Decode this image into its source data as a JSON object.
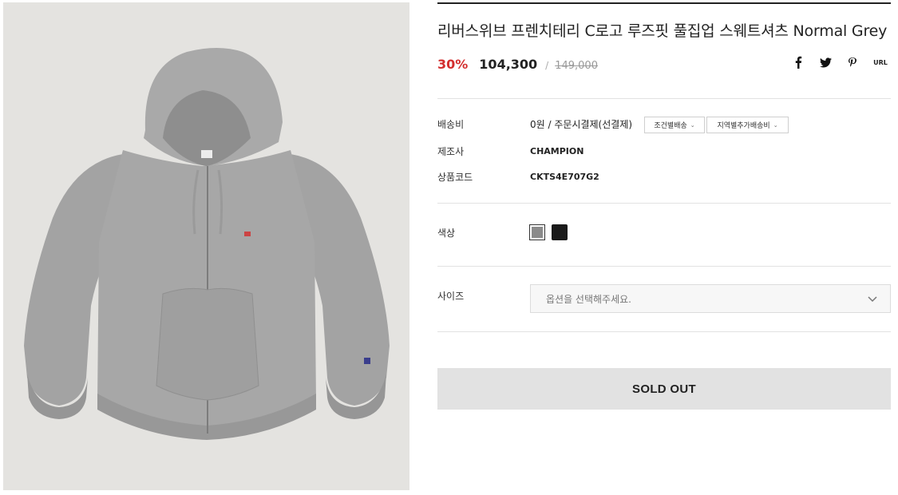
{
  "product": {
    "image_alt": "Champion grey full zip hoodie",
    "title": "리버스위브 프렌치테리 C로고 루즈핏 풀집업 스웨트셔츠 Normal Grey",
    "discount": "30%",
    "sale_price": "104,300",
    "price_slash": "/",
    "original_price": "149,000"
  },
  "share": {
    "facebook_icon": "facebook-icon",
    "twitter_icon": "twitter-icon",
    "pinterest_icon": "pinterest-icon",
    "url_label": "URL"
  },
  "details": {
    "shipping_label": "배송비",
    "shipping_value": "0원  / 주문시결제(선결제)",
    "condition_button": "조건별배송",
    "region_button": "지역별추가배송비",
    "maker_label": "제조사",
    "maker_value": "CHAMPION",
    "code_label": "상품코드",
    "code_value": "CKTS4E707G2"
  },
  "options": {
    "color_label": "색상",
    "colors": [
      {
        "name": "Normal Grey",
        "hex": "#8b8b8b",
        "selected": true
      },
      {
        "name": "Black",
        "hex": "#1a1a1a",
        "selected": false
      }
    ],
    "size_label": "사이즈",
    "size_placeholder": "옵션을 선택해주세요."
  },
  "actions": {
    "sold_out_label": "SOLD OUT"
  },
  "colors": {
    "discount_red": "#d32f2f",
    "button_grey": "#e2e2e2",
    "image_background": "#e4e3e0"
  }
}
